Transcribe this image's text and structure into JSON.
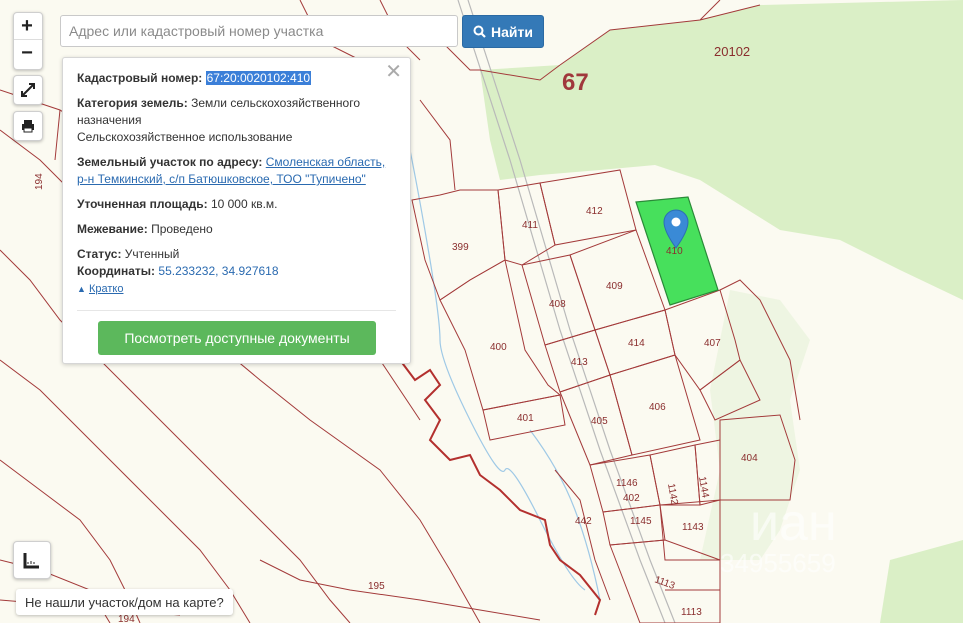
{
  "search": {
    "placeholder": "Адрес или кадастровый номер участка",
    "button_label": "Найти"
  },
  "controls": {
    "zoom_in": "+",
    "zoom_out": "−"
  },
  "popup": {
    "cadastral_label": "Кадастровый номер:",
    "cadastral_value": "67:20:0020102:410",
    "category_label": "Категория земель:",
    "category_value": "Земли сельскохозяйственного назначения",
    "usage_value": "Сельскохозяйственное использование",
    "address_label": "Земельный участок по адресу:",
    "address_value": "Смоленская область, р-н Темкинский, с/п Батюшковское, ТОО \"Тупичено\"",
    "area_label": "Уточненная площадь:",
    "area_value": "10 000 кв.м.",
    "survey_label": "Межевание:",
    "survey_value": "Проведено",
    "status_label": "Статус:",
    "status_value": "Учтенный",
    "coords_label": "Координаты:",
    "coords_value": "55.233232, 34.927618",
    "collapse_link": "Кратко",
    "docs_button": "Посмотреть доступные документы"
  },
  "not_found": "Не нашли участок/дом на карте?",
  "map": {
    "region_label": "67",
    "quarter_label": "20102",
    "watermark": "иан",
    "watermark_phone": "34955659",
    "parcels": [
      "194",
      "194",
      "194",
      "195",
      "399",
      "400",
      "401",
      "402",
      "404",
      "405",
      "406",
      "407",
      "408",
      "409",
      "410",
      "411",
      "412",
      "413",
      "414",
      "442",
      "1113",
      "1113",
      "1142",
      "1143",
      "1144",
      "1145",
      "1146"
    ],
    "colors": {
      "boundary": "#a33a3a",
      "selected_fill": "#47e05c",
      "forest": "#daefc6",
      "river": "#b3302e",
      "water": "#9fc9e6",
      "marker": "#3a8ad6"
    }
  }
}
